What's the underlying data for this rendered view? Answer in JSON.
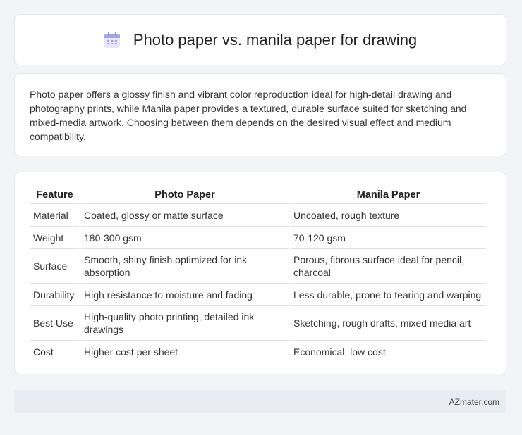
{
  "header": {
    "title": "Photo paper vs. manila paper for drawing",
    "icon": "calendar-icon"
  },
  "intro": {
    "text": "Photo paper offers a glossy finish and vibrant color reproduction ideal for high-detail drawing and photography prints, while Manila paper provides a textured, durable surface suited for sketching and mixed-media artwork. Choosing between them depends on the desired visual effect and medium compatibility."
  },
  "table": {
    "headers": [
      "Feature",
      "Photo Paper",
      "Manila Paper"
    ],
    "rows": [
      [
        "Material",
        "Coated, glossy or matte surface",
        "Uncoated, rough texture"
      ],
      [
        "Weight",
        "180-300 gsm",
        "70-120 gsm"
      ],
      [
        "Surface",
        "Smooth, shiny finish optimized for ink absorption",
        "Porous, fibrous surface ideal for pencil, charcoal"
      ],
      [
        "Durability",
        "High resistance to moisture and fading",
        "Less durable, prone to tearing and warping"
      ],
      [
        "Best Use",
        "High-quality photo printing, detailed ink drawings",
        "Sketching, rough drafts, mixed media art"
      ],
      [
        "Cost",
        "Higher cost per sheet",
        "Economical, low cost"
      ]
    ]
  },
  "footer": {
    "text": "AZmater.com"
  }
}
